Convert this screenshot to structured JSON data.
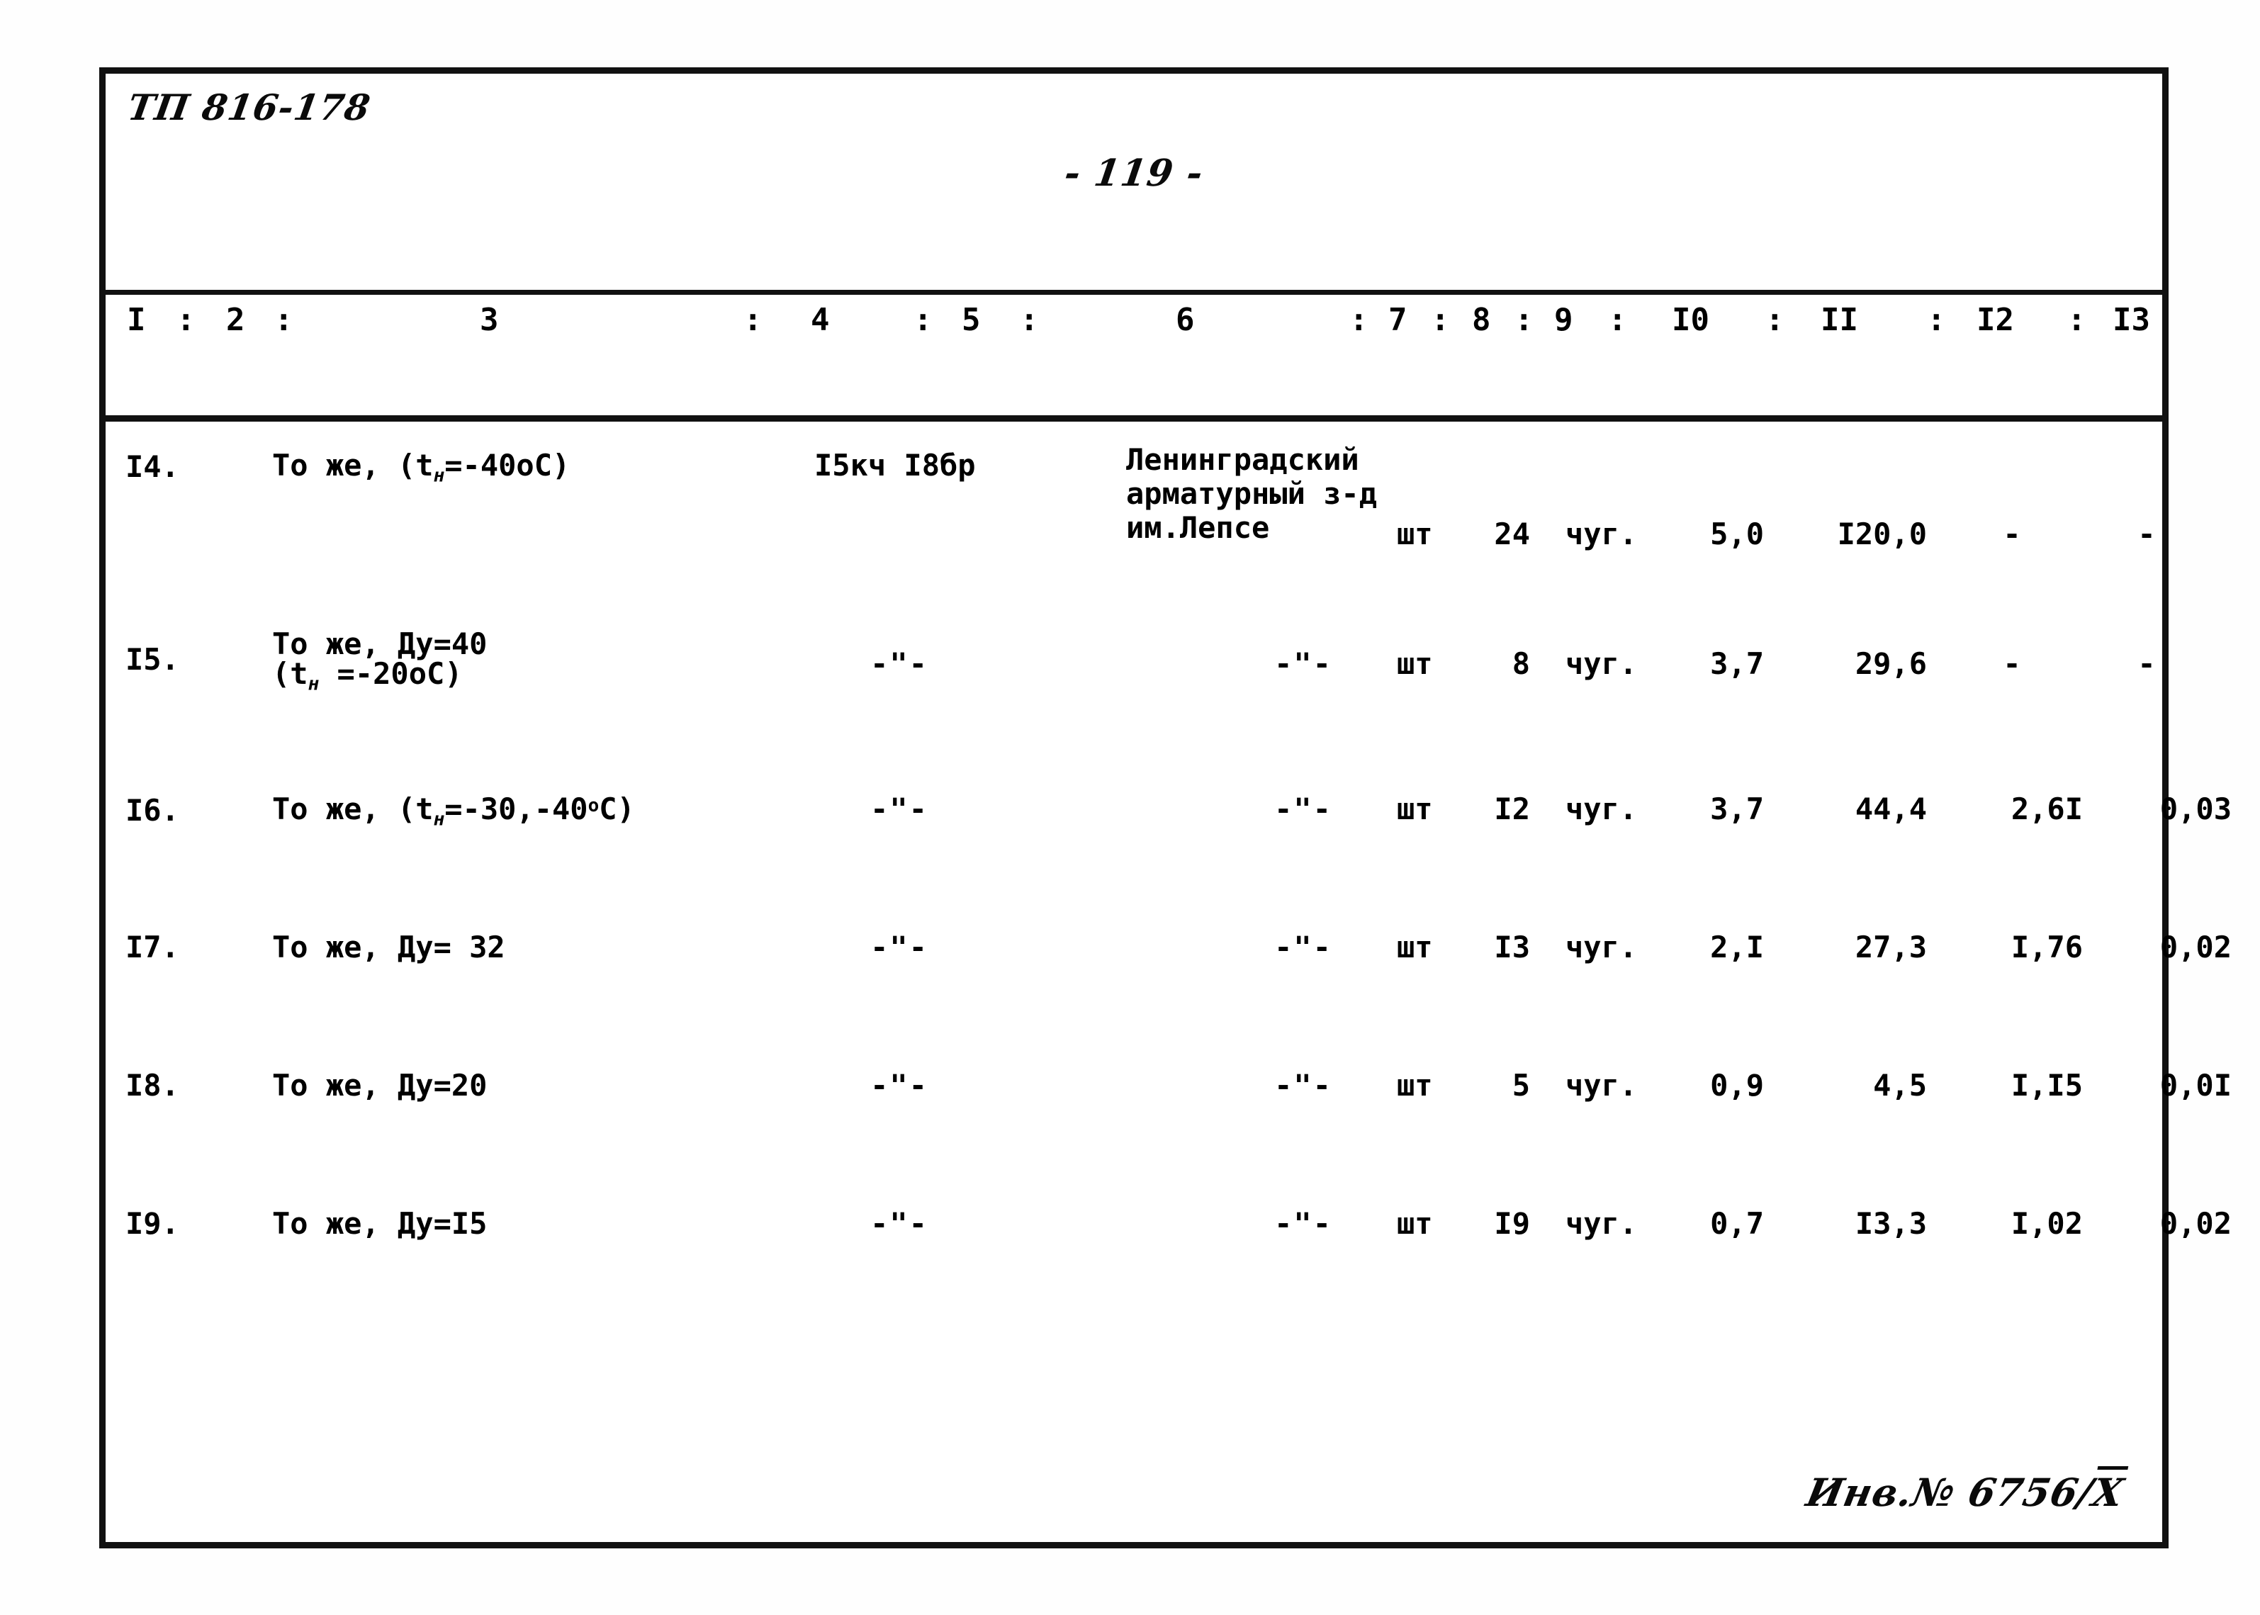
{
  "document": {
    "code": "ТП 816-178",
    "page_label": "- 119 -",
    "inventory_stamp_prefix": "Инв.№ 6756/",
    "inventory_stamp_suffix": "X"
  },
  "table": {
    "column_numbers": [
      "I",
      "2",
      "3",
      "4",
      "5",
      "6",
      "7",
      "8",
      "9",
      "I0",
      "II",
      "I2",
      "I3"
    ],
    "separator": ":",
    "rows": [
      {
        "num": "I4.",
        "name_line1": "То же, (t",
        "name_sub": "н",
        "name_line1_tail": "=-40оС)",
        "col4": "I5кч I8бр",
        "col6_line1": "Ленинградский",
        "col6_line2": "арматурный з-д",
        "col6_line3": "им.Лепсе",
        "unit": "шт",
        "qty": "24",
        "material": "чуг.",
        "col10": "5,0",
        "col11": "I20,0",
        "col12": "-",
        "col13": "-"
      },
      {
        "num": "I5.",
        "name_line1": "То же, Ду=40",
        "name_line2": "(t",
        "name_sub": "н",
        "name_line2_tail": " =-20оС)",
        "col4": "-\"-",
        "col6_line1": "-\"-",
        "col6_line2": "",
        "col6_line3": "",
        "unit": "шт",
        "qty": "8",
        "material": "чуг.",
        "col10": "3,7",
        "col11": "29,6",
        "col12": "-",
        "col13": "-"
      },
      {
        "num": "I6.",
        "name_line1": "То же, (t",
        "name_sub": "н",
        "name_line1_tail": "=-30,-40",
        "name_sup": "о",
        "name_line1_end": "С)",
        "col4": "-\"-",
        "col6_line1": "-\"-",
        "col6_line2": "",
        "col6_line3": "",
        "unit": "шт",
        "qty": "I2",
        "material": "чуг.",
        "col10": "3,7",
        "col11": "44,4",
        "col12": "2,6I",
        "col13": "0,03"
      },
      {
        "num": "I7.",
        "name_line1": "То же, Ду= 32",
        "col4": "-\"-",
        "col6_line1": "-\"-",
        "col6_line2": "",
        "col6_line3": "",
        "unit": "шт",
        "qty": "I3",
        "material": "чуг.",
        "col10": "2,I",
        "col11": "27,3",
        "col12": "I,76",
        "col13": "0,02"
      },
      {
        "num": "I8.",
        "name_line1": "То же, Ду=20",
        "col4": "-\"-",
        "col6_line1": "-\"-",
        "col6_line2": "",
        "col6_line3": "",
        "unit": "шт",
        "qty": "5",
        "material": "чуг.",
        "col10": "0,9",
        "col11": "4,5",
        "col12": "I,I5",
        "col13": "0,0I"
      },
      {
        "num": "I9.",
        "name_line1": "То же, Ду=I5",
        "col4": "-\"-",
        "col6_line1": "-\"-",
        "col6_line2": "",
        "col6_line3": "",
        "unit": "шт",
        "qty": "I9",
        "material": "чуг.",
        "col10": "0,7",
        "col11": "I3,3",
        "col12": "I,02",
        "col13": "0,02"
      }
    ]
  }
}
